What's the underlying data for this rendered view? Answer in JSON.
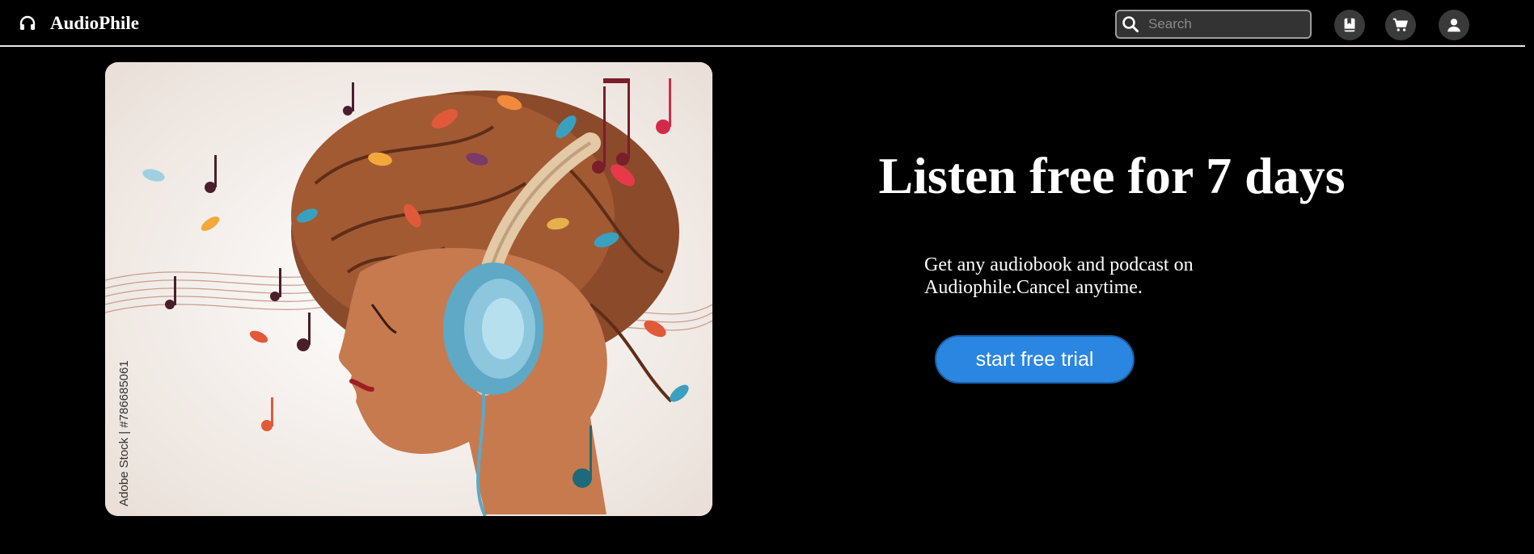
{
  "header": {
    "brand": "AudioPhile",
    "brand_icon": "headphones-icon",
    "search": {
      "placeholder": "Search",
      "value": "",
      "icon": "search-icon"
    },
    "actions": [
      {
        "name": "library-button",
        "icon": "bookmark-book-icon"
      },
      {
        "name": "cart-button",
        "icon": "cart-icon"
      },
      {
        "name": "account-button",
        "icon": "user-icon"
      }
    ]
  },
  "hero": {
    "title": "Listen free for 7 days",
    "subtitle": "Get any audiobook and podcast on Audiophile.Cancel anytime.",
    "cta_label": "start free trial",
    "image_watermark": "Adobe Stock | #786685061"
  },
  "colors": {
    "background": "#000000",
    "accent": "#2a86e0",
    "divider": "#f0e6e0"
  }
}
